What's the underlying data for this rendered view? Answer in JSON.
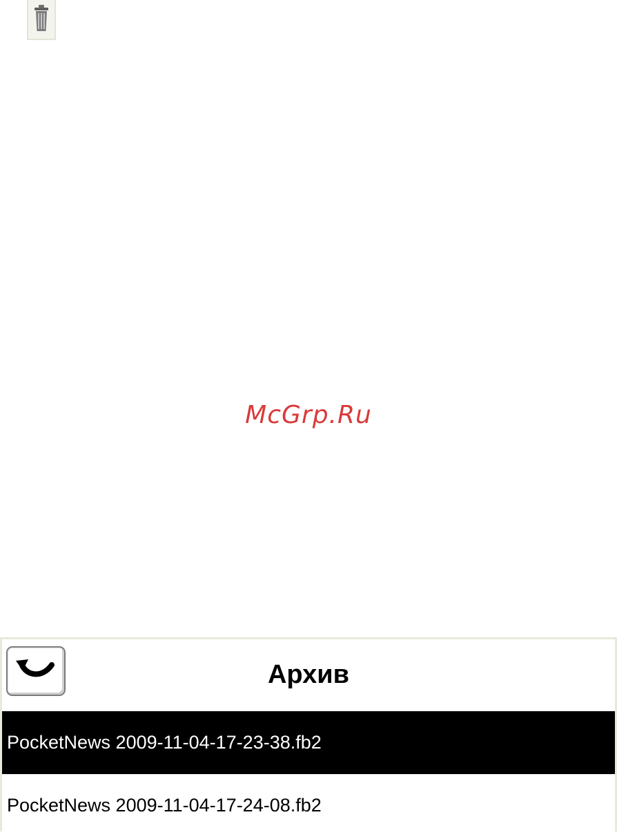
{
  "toolbar": {
    "delete_icon": "trash-icon"
  },
  "watermark": {
    "text": "McGrp.Ru"
  },
  "panel": {
    "back_icon": "back-arrow-icon",
    "title": "Архив",
    "files": [
      {
        "name": "PocketNews 2009-11-04-17-23-38.fb2",
        "selected": true
      },
      {
        "name": "PocketNews 2009-11-04-17-24-08.fb2",
        "selected": false
      }
    ]
  },
  "colors": {
    "watermark": "#d93a3a",
    "selection_bg": "#000000",
    "selection_fg": "#ffffff",
    "panel_border": "#e8e8dc"
  }
}
